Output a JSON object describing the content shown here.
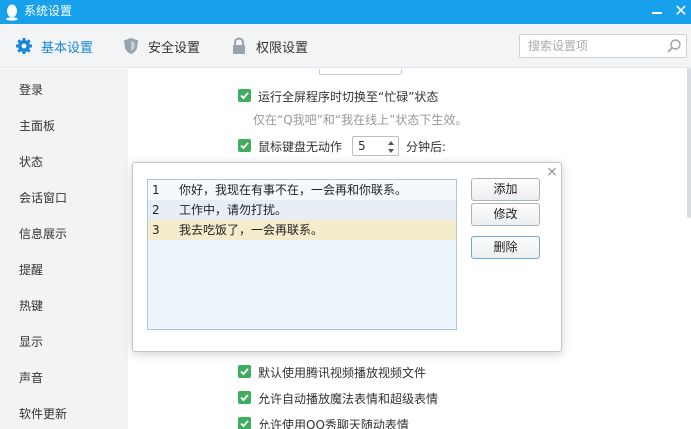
{
  "window": {
    "title": "系统设置"
  },
  "tabs": [
    {
      "label": "基本设置"
    },
    {
      "label": "安全设置"
    },
    {
      "label": "权限设置"
    }
  ],
  "search": {
    "placeholder": "搜索设置项"
  },
  "sidebar": {
    "items": [
      {
        "label": "登录"
      },
      {
        "label": "主面板"
      },
      {
        "label": "状态"
      },
      {
        "label": "会话窗口"
      },
      {
        "label": "信息展示"
      },
      {
        "label": "提醒"
      },
      {
        "label": "热键"
      },
      {
        "label": "显示"
      },
      {
        "label": "声音"
      },
      {
        "label": "软件更新"
      }
    ]
  },
  "main": {
    "options": [
      {
        "label": "运行全屏程序时切换至“忙碌”状态",
        "checked": true
      },
      {
        "label": "鼠标键盘无动作",
        "checked": true
      },
      {
        "label": "默认使用腾讯视频播放视频文件",
        "checked": true
      },
      {
        "label": "允许自动播放魔法表情和超级表情",
        "checked": true
      },
      {
        "label": "允许使用QQ秀聊天随动表情",
        "checked": true
      }
    ],
    "hint": "仅在“Q我吧”和“我在线上”状态下生效。",
    "idle_minutes": "5",
    "idle_suffix": "分钟后:"
  },
  "dialog": {
    "messages": [
      {
        "num": "1",
        "text": "你好，我现在有事不在，一会再和你联系。"
      },
      {
        "num": "2",
        "text": "工作中，请勿打扰。"
      },
      {
        "num": "3",
        "text": "我去吃饭了，一会再联系。"
      }
    ],
    "selected_index": 2,
    "buttons": {
      "add": "添加",
      "edit": "修改",
      "delete": "删除"
    },
    "close": "×"
  },
  "colors": {
    "titlebar": "#17a0eb",
    "accent": "#1987d6",
    "checkbox": "#3fad5e",
    "selected_row": "#f5eccc"
  }
}
